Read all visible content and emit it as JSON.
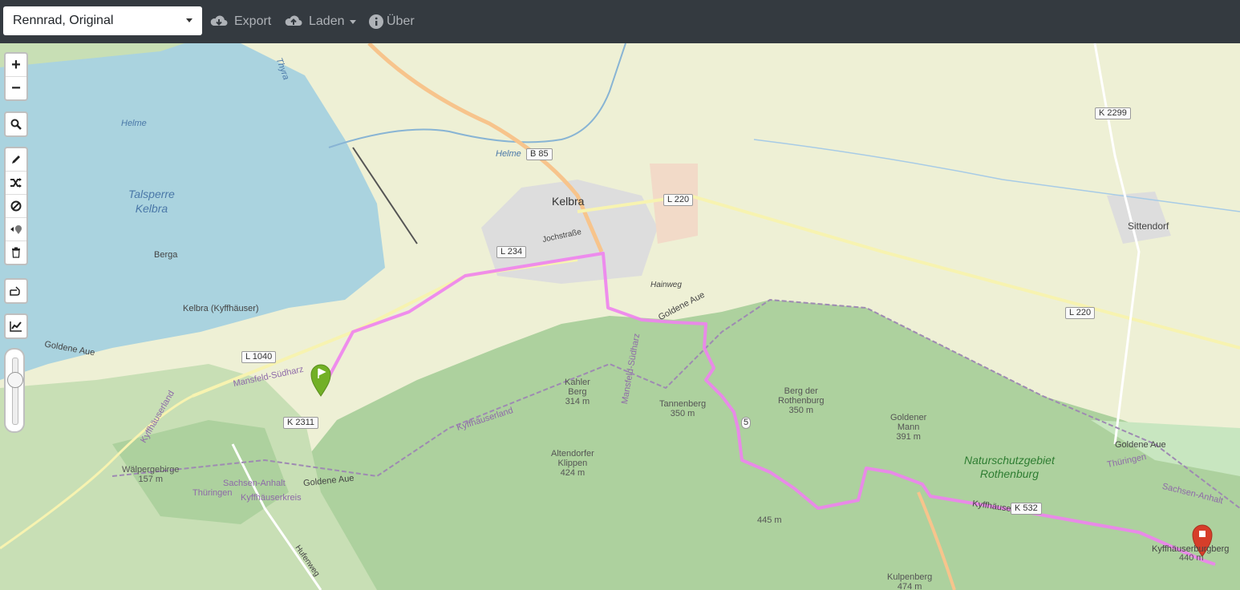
{
  "toolbar": {
    "profile_value": "Rennrad, Original",
    "export_label": "Export",
    "load_label": "Laden",
    "about_label": "Über"
  },
  "controls": {
    "zoom_in": "+",
    "zoom_out": "−"
  },
  "map": {
    "places": {
      "kelbra": "Kelbra",
      "sittendorf": "Sittendorf",
      "berga": "Berga",
      "kelbra_kyffhauser": "Kelbra (Kyffhäuser)",
      "jochstrasse": "Jochstraße",
      "hainweg": "Hainweg",
      "goldene_aue_1": "Goldene Aue",
      "goldene_aue_2": "Goldene Aue",
      "goldene_aue_3": "Goldene Aue",
      "goldene_aue_4": "Goldene Aue",
      "mansfeld_suedharz_1": "Mansfeld-Südharz",
      "mansfeld_suedharz_2": "Mansfeld-Südharz",
      "kyffhaeuserland_1": "Kyffhäuserland",
      "kyffhaeuserland_2": "Kyffhäuserland",
      "kyffhaeuserkreis": "Kyffhäuserkreis",
      "sachsen_anhalt_1": "Sachsen-Anhalt",
      "sachsen_anhalt_2": "Sachsen-Anhalt",
      "thueringen_1": "Thüringen",
      "thueringen_2": "Thüringen",
      "hufenweg": "Hufenweg",
      "kyffhaeuser_road": "Kyffhäuser",
      "kyffhaeuserburgberg": "Kyffhäuserburgberg"
    },
    "water": {
      "helme_1": "Helme",
      "helme_2": "Helme",
      "thyra": "Thyra",
      "talsperre": "Talsperre\nKelbra"
    },
    "roads": {
      "b85": "B 85",
      "l220_a": "L 220",
      "l220_b": "L 220",
      "l234": "L 234",
      "l1040": "L 1040",
      "k2311": "K 2311",
      "k2299": "K 2299",
      "k532": "K 532",
      "route5": "5"
    },
    "peaks": {
      "kahler_berg": "Kahler\nBerg\n314 m",
      "tannenberg": "Tannenberg\n350 m",
      "berg_rothenburg": "Berg der\nRothenburg\n350 m",
      "goldener_mann": "Goldener\nMann\n391 m",
      "altendorfer": "Altendorfer\nKlippen\n424 m",
      "p445": "445 m",
      "walpergebirge": "Wälpergebirge\n157 m",
      "kulpenberg": "Kulpenberg\n474 m",
      "burgberg_height": "440 m"
    },
    "reserve": "Naturschutzgebiet\nRothenburg"
  },
  "colors": {
    "toolbar_bg": "#343a40",
    "route": "#ee82ee",
    "start_marker": "#72b026",
    "end_marker": "#d63e2a"
  }
}
